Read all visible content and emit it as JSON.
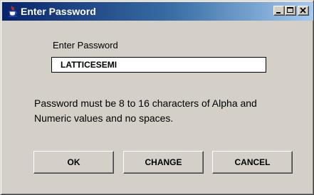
{
  "window": {
    "title": "Enter Password",
    "titlebar_colors": [
      "#0a246a",
      "#a6caf0"
    ],
    "icon": "java-cup-icon"
  },
  "form": {
    "password_label": "Enter Password",
    "password_value": "LATTICESEMI",
    "info_line1": "Password must be 8 to 16 characters of Alpha and",
    "info_line2": "Numeric values and no spaces."
  },
  "buttons": {
    "ok": "OK",
    "change": "CHANGE",
    "cancel": "CANCEL"
  }
}
